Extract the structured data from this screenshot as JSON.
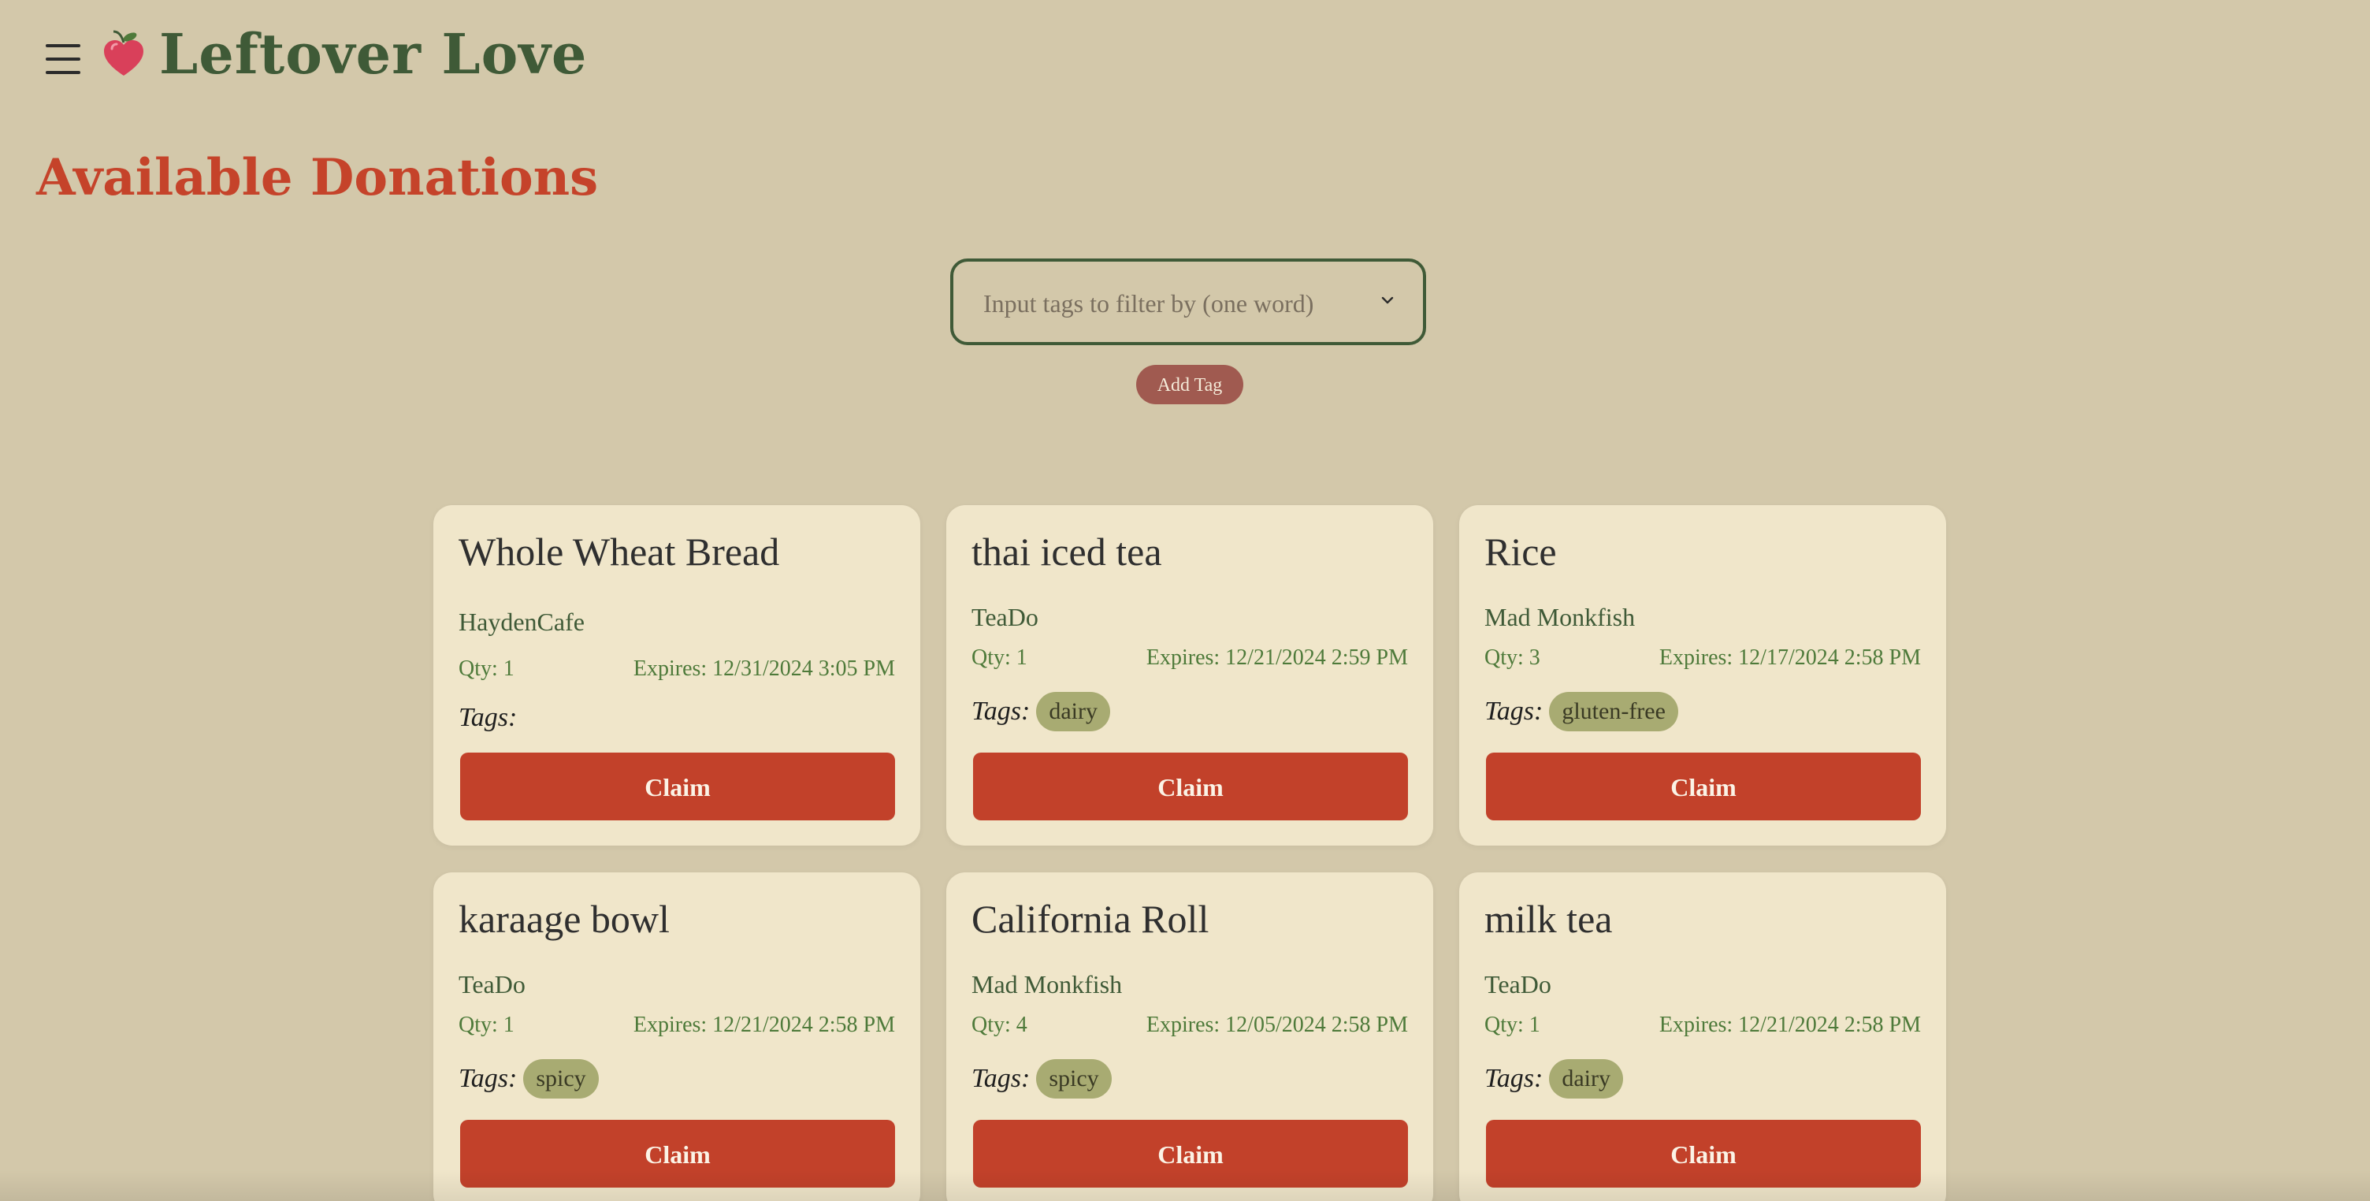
{
  "header": {
    "brand": "Leftover Love",
    "menu_icon": "hamburger-menu-icon",
    "logo_icon": "heart-apple-icon"
  },
  "page": {
    "heading": "Available Donations"
  },
  "filter": {
    "placeholder": "Input tags to filter by (one word)",
    "value": "",
    "add_tag_label": "Add Tag"
  },
  "labels": {
    "tags": "Tags:",
    "claim": "Claim"
  },
  "colors": {
    "background": "#d3c8aa",
    "brand_green": "#3f5a37",
    "accent_red": "#c5432a",
    "card_bg": "#f0e6ca",
    "tag_chip": "#a8ab72"
  },
  "donations": [
    {
      "title": "Whole Wheat Bread",
      "vendor": "HaydenCafe",
      "qty": "Qty: 1",
      "expires": "Expires: 12/31/2024 3:05 PM",
      "tags": []
    },
    {
      "title": "thai iced tea",
      "vendor": "TeaDo",
      "qty": "Qty: 1",
      "expires": "Expires: 12/21/2024 2:59 PM",
      "tags": [
        "dairy"
      ]
    },
    {
      "title": "Rice",
      "vendor": "Mad Monkfish",
      "qty": "Qty: 3",
      "expires": "Expires: 12/17/2024 2:58 PM",
      "tags": [
        "gluten-free"
      ]
    },
    {
      "title": "karaage bowl",
      "vendor": "TeaDo",
      "qty": "Qty: 1",
      "expires": "Expires: 12/21/2024 2:58 PM",
      "tags": [
        "spicy"
      ]
    },
    {
      "title": "California Roll",
      "vendor": "Mad Monkfish",
      "qty": "Qty: 4",
      "expires": "Expires: 12/05/2024 2:58 PM",
      "tags": [
        "spicy"
      ]
    },
    {
      "title": "milk tea",
      "vendor": "TeaDo",
      "qty": "Qty: 1",
      "expires": "Expires: 12/21/2024 2:58 PM",
      "tags": [
        "dairy"
      ]
    }
  ]
}
